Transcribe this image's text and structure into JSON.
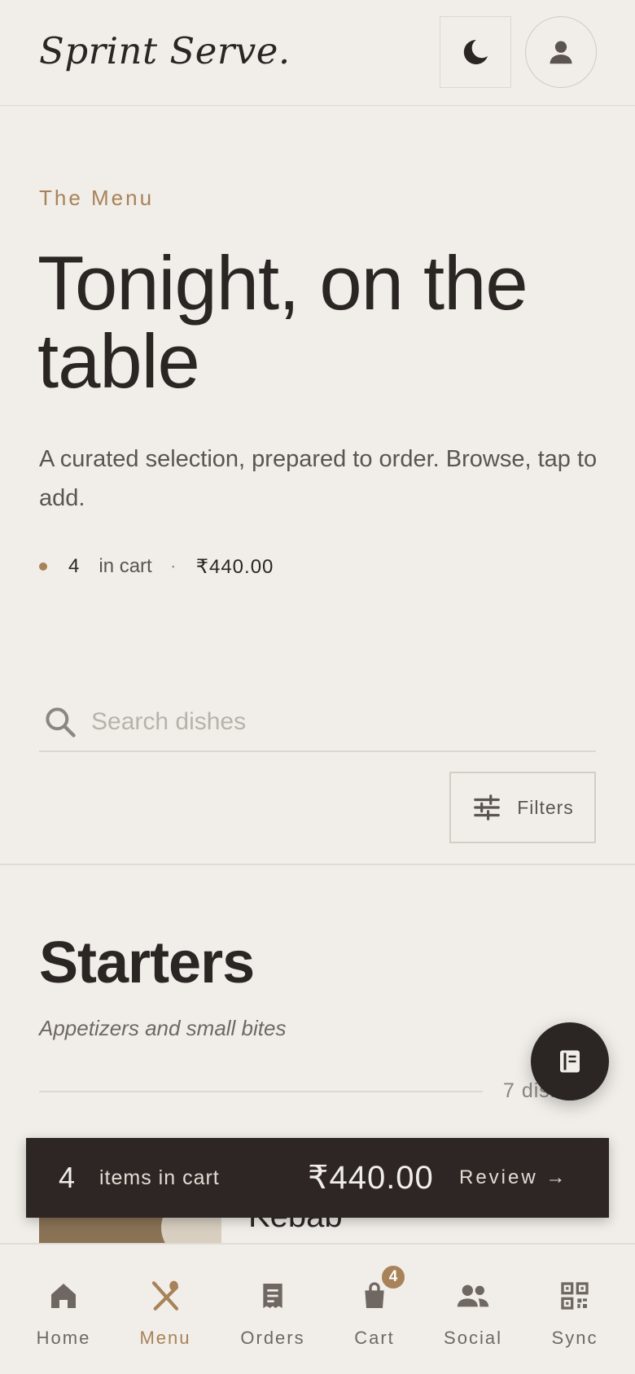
{
  "header": {
    "brand": "Sprint Serve.",
    "theme_icon": "moon-icon",
    "profile_icon": "user-icon"
  },
  "hero": {
    "eyebrow": "The Menu",
    "title": "Tonight, on the table",
    "subtitle": "A curated selection, prepared to order. Browse, tap to add.",
    "cart_count": "4",
    "cart_label": "in cart",
    "separator": "·",
    "cart_total": "₹440.00"
  },
  "search": {
    "placeholder": "Search dishes",
    "value": ""
  },
  "filters": {
    "label": "Filters"
  },
  "section": {
    "title": "Starters",
    "subtitle": "Appetizers and small bites",
    "count": "7 dishes"
  },
  "dish_peek": {
    "name": "Kebab"
  },
  "cart_bar": {
    "count": "4",
    "label": "items in cart",
    "total": "₹440.00",
    "review": "Review →"
  },
  "nav": {
    "items": [
      {
        "label": "Home",
        "icon": "home-icon"
      },
      {
        "label": "Menu",
        "icon": "utensils-icon",
        "active": true
      },
      {
        "label": "Orders",
        "icon": "receipt-icon"
      },
      {
        "label": "Cart",
        "icon": "bag-icon",
        "badge": "4"
      },
      {
        "label": "Social",
        "icon": "people-icon"
      },
      {
        "label": "Sync",
        "icon": "qr-icon"
      }
    ]
  },
  "colors": {
    "background": "#f1eee9",
    "accent": "#a88258",
    "dark": "#2b2523",
    "muted": "#6f6762"
  }
}
